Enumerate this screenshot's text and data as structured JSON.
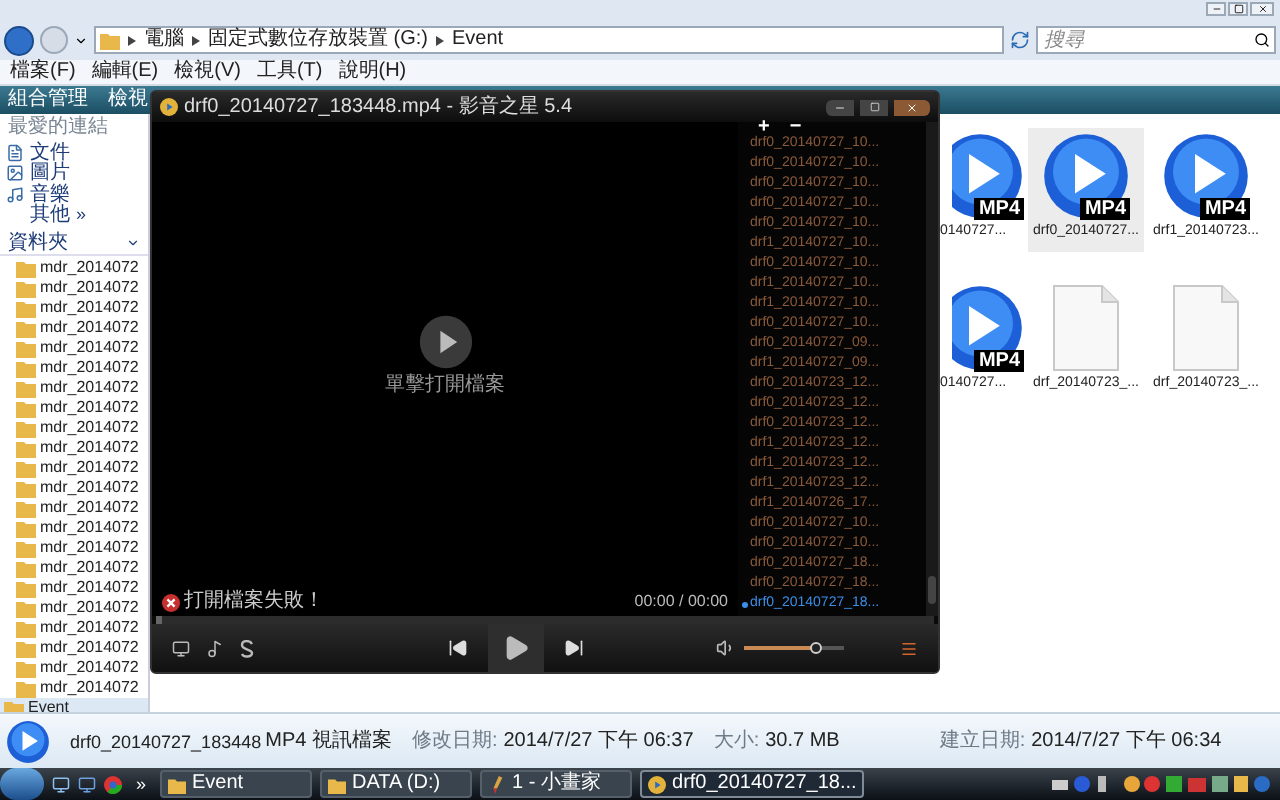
{
  "address_bar": {
    "breadcrumbs": [
      "電腦",
      "固定式數位存放裝置 (G:)",
      "Event"
    ]
  },
  "search": {
    "placeholder": "搜尋"
  },
  "menu": [
    "檔案(F)",
    "編輯(E)",
    "檢視(V)",
    "工具(T)",
    "說明(H)"
  ],
  "toolbar": [
    "組合管理",
    "檢視"
  ],
  "favorites": {
    "title": "最愛的連結",
    "items": [
      {
        "label": "文件",
        "kind": "doc"
      },
      {
        "label": "圖片",
        "kind": "image"
      },
      {
        "label": "音樂",
        "kind": "music"
      },
      {
        "label": "其他",
        "more": "»",
        "kind": "none"
      }
    ]
  },
  "folders": {
    "title": "資料夾",
    "items": [
      {
        "children": [
          {
            "label": "mdr_2014072",
            "selected": false
          },
          {
            "label": "mdr_2014072",
            "selected": false
          },
          {
            "label": "mdr_2014072",
            "selected": false
          },
          {
            "label": "mdr_2014072",
            "selected": false
          },
          {
            "label": "mdr_2014072",
            "selected": false
          },
          {
            "label": "mdr_2014072",
            "selected": false
          },
          {
            "label": "mdr_2014072",
            "selected": false
          },
          {
            "label": "mdr_2014072",
            "selected": false
          },
          {
            "label": "mdr_2014072",
            "selected": false
          },
          {
            "label": "mdr_2014072",
            "selected": false
          },
          {
            "label": "mdr_2014072",
            "selected": false
          },
          {
            "label": "mdr_2014072",
            "selected": false
          },
          {
            "label": "mdr_2014072",
            "selected": false
          },
          {
            "label": "mdr_2014072",
            "selected": false
          },
          {
            "label": "mdr_2014072",
            "selected": false
          },
          {
            "label": "mdr_2014072",
            "selected": false
          },
          {
            "label": "mdr_2014072",
            "selected": false
          },
          {
            "label": "mdr_2014072",
            "selected": false
          },
          {
            "label": "mdr_2014072",
            "selected": false
          },
          {
            "label": "mdr_2014072",
            "selected": false
          },
          {
            "label": "mdr_2014072",
            "selected": false
          },
          {
            "label": "mdr_2014072",
            "selected": false
          }
        ]
      },
      {
        "label": "Event",
        "selected": true
      }
    ]
  },
  "files": [
    {
      "kind": "video",
      "badge": "MP4",
      "name": "0140727...",
      "selected": false,
      "clipped": true
    },
    {
      "kind": "video",
      "badge": "MP4",
      "name": "drf0_20140727...",
      "selected": true,
      "clipped": false
    },
    {
      "kind": "video",
      "badge": "MP4",
      "name": "drf1_20140723...",
      "selected": false,
      "clipped": false
    },
    {
      "kind": "video",
      "badge": "MP4",
      "name": "0140727...",
      "selected": false,
      "clipped": true
    },
    {
      "kind": "text",
      "name": "drf_20140723_...",
      "selected": false,
      "clipped": false
    },
    {
      "kind": "text",
      "name": "drf_20140723_...",
      "selected": false,
      "clipped": false
    }
  ],
  "player": {
    "title": "drf0_20140727_183448.mp4 - 影音之星 5.4",
    "hint": "單擊打開檔案",
    "error": "打開檔案失敗！",
    "time": "00:00 / 00:00",
    "seek": {
      "level": 0
    },
    "volume": {
      "level": 0.72
    },
    "playlist": {
      "buttons": [
        "+",
        "−"
      ],
      "items": [
        {
          "label": "drf0_20140727_10...",
          "selected": false
        },
        {
          "label": "drf0_20140727_10...",
          "selected": false
        },
        {
          "label": "drf0_20140727_10...",
          "selected": false
        },
        {
          "label": "drf0_20140727_10...",
          "selected": false
        },
        {
          "label": "drf0_20140727_10...",
          "selected": false
        },
        {
          "label": "drf1_20140727_10...",
          "selected": false
        },
        {
          "label": "drf0_20140727_10...",
          "selected": false
        },
        {
          "label": "drf1_20140727_10...",
          "selected": false
        },
        {
          "label": "drf1_20140727_10...",
          "selected": false
        },
        {
          "label": "drf0_20140727_10...",
          "selected": false
        },
        {
          "label": "drf0_20140727_09...",
          "selected": false
        },
        {
          "label": "drf1_20140727_09...",
          "selected": false
        },
        {
          "label": "drf0_20140723_12...",
          "selected": false
        },
        {
          "label": "drf0_20140723_12...",
          "selected": false
        },
        {
          "label": "drf0_20140723_12...",
          "selected": false
        },
        {
          "label": "drf1_20140723_12...",
          "selected": false
        },
        {
          "label": "drf1_20140723_12...",
          "selected": false
        },
        {
          "label": "drf1_20140723_12...",
          "selected": false
        },
        {
          "label": "drf1_20140726_17...",
          "selected": false
        },
        {
          "label": "drf0_20140727_10...",
          "selected": false
        },
        {
          "label": "drf0_20140727_10...",
          "selected": false
        },
        {
          "label": "drf0_20140727_18...",
          "selected": false
        },
        {
          "label": "drf0_20140727_18...",
          "selected": false
        },
        {
          "label": "drf0_20140727_18...",
          "selected": true
        }
      ]
    }
  },
  "details": {
    "title": "drf0_20140727_183448",
    "type": "MP4 視訊檔案",
    "fields": [
      {
        "label": "修改日期:",
        "value": "2014/7/27 下午 06:37"
      },
      {
        "label": "大小:",
        "value": "30.7 MB"
      },
      {
        "label": "建立日期:",
        "value": "2014/7/27 下午 06:34"
      }
    ]
  },
  "taskbar": {
    "more": "»",
    "tasks": [
      {
        "label": "Event",
        "kind": "folder",
        "selected": false
      },
      {
        "label": "DATA (D:)",
        "kind": "folder",
        "selected": false
      },
      {
        "label": "1 - 小畫家",
        "kind": "paint",
        "selected": false
      },
      {
        "label": "drf0_20140727_18...",
        "kind": "player",
        "selected": true
      }
    ]
  }
}
